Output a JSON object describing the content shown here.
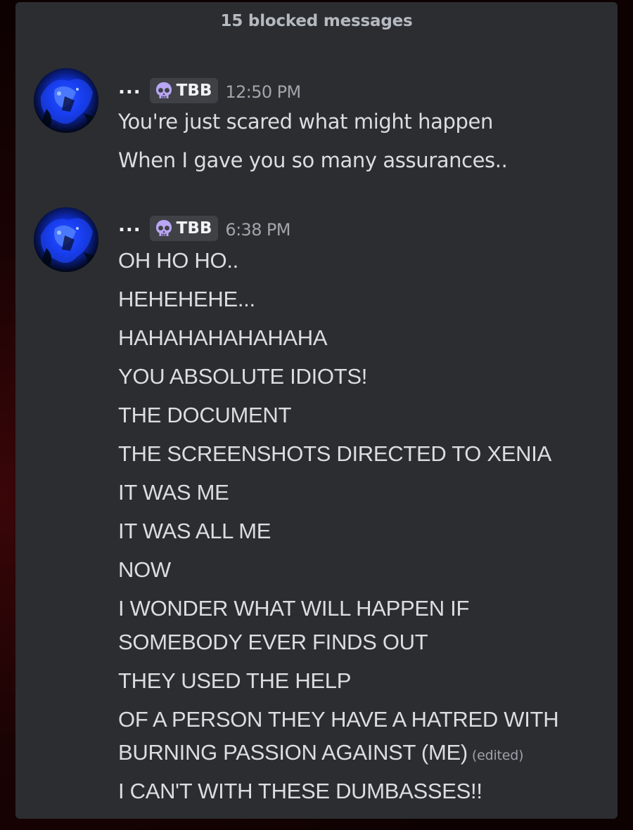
{
  "blocked_notice": "15 blocked messages",
  "messages": [
    {
      "username": "...",
      "tag": "TBB",
      "time": "12:50 PM",
      "lines": [
        "You're just scared what might happen",
        "When I gave you so many assurances.."
      ]
    },
    {
      "username": "...",
      "tag": "TBB",
      "time": "6:38 PM",
      "lines": [
        "OH HO HO..",
        "HEHEHEHE...",
        "HAHAHAHAHAHAHA",
        "YOU ABSOLUTE IDIOTS!",
        "THE DOCUMENT",
        "THE SCREENSHOTS DIRECTED TO XENIA",
        "IT WAS ME",
        "IT WAS ALL ME",
        "NOW",
        "I WONDER WHAT WILL HAPPEN IF",
        "SOMEBODY EVER FINDS OUT",
        "THEY USED THE HELP",
        "OF A PERSON THEY HAVE A HATRED WITH",
        "BURNING PASSION AGAINST (ME)",
        "I CAN'T WITH THESE DUMBASSES!!"
      ],
      "edited_label": "(edited)"
    }
  ],
  "icons": {
    "tag_icon": "skull-icon",
    "tag_icon_color": "#b9a6f5"
  },
  "colors": {
    "panel_background": "#2b2d31",
    "text": "#dbdee1",
    "muted": "#a0a4ab"
  }
}
